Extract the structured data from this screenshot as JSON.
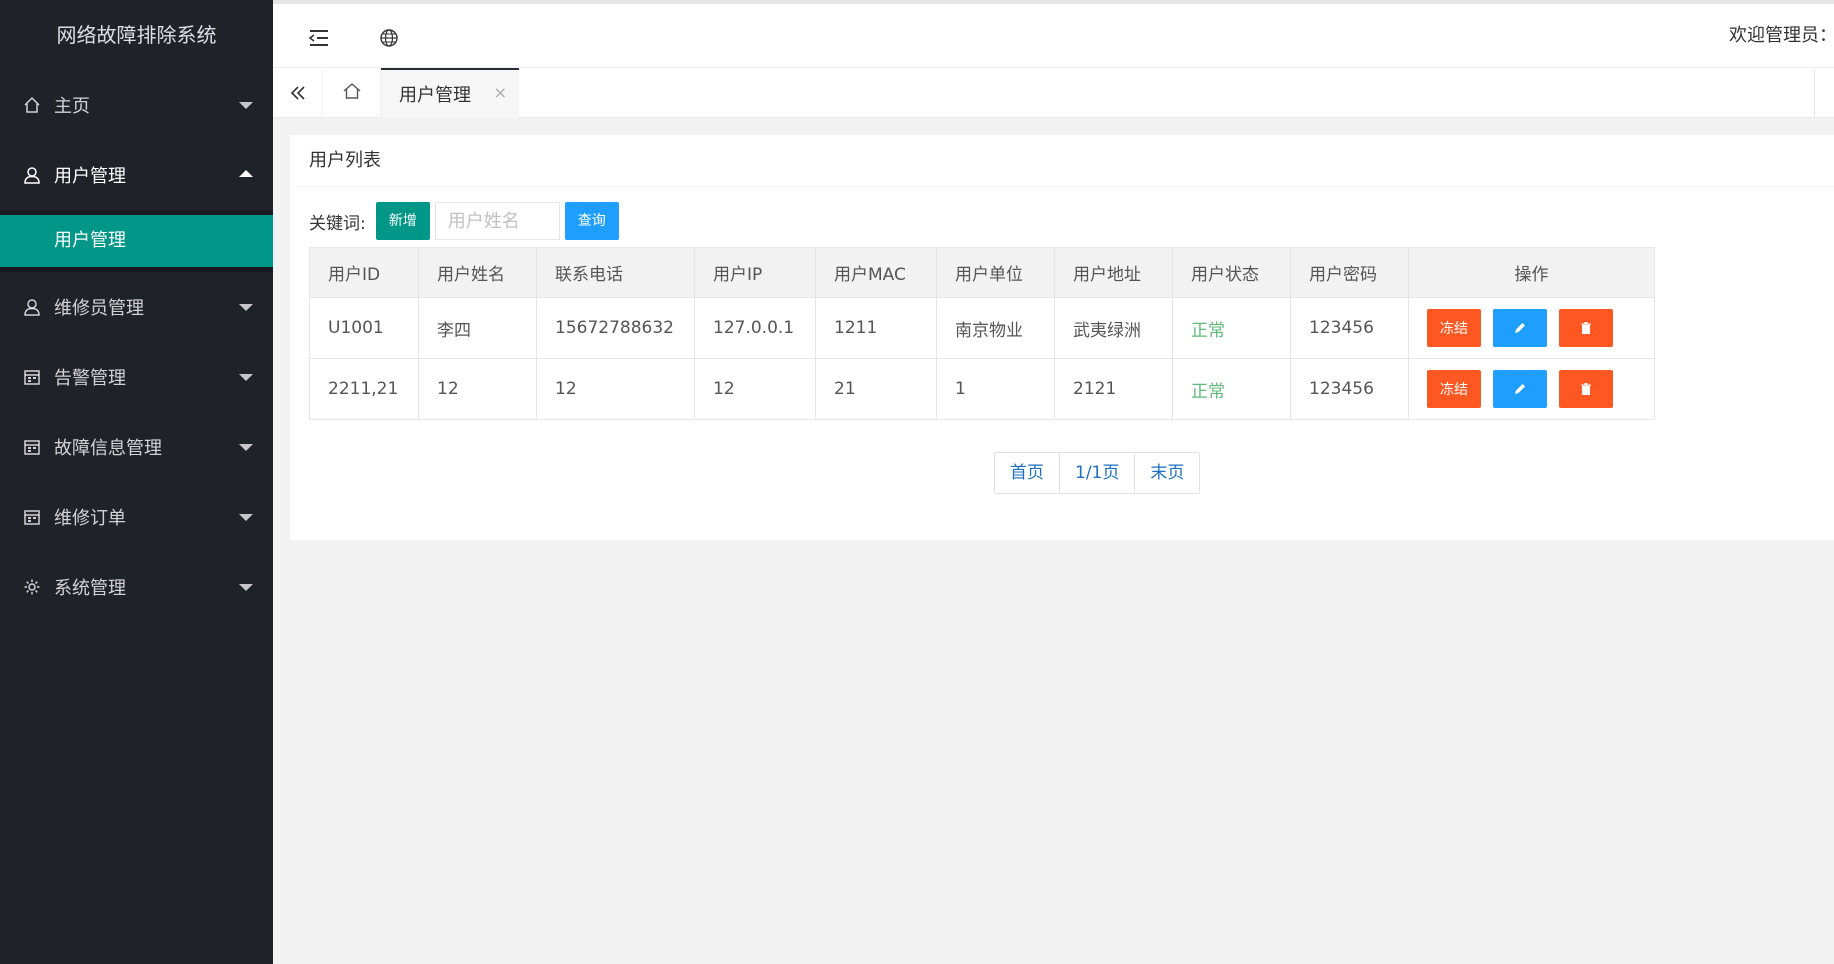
{
  "app": {
    "title": "网络故障排除系统"
  },
  "sidebar": {
    "items": [
      {
        "label": "主页",
        "icon": "home-icon"
      },
      {
        "label": "用户管理",
        "icon": "user-icon",
        "open": true,
        "children": [
          {
            "label": "用户管理"
          }
        ]
      },
      {
        "label": "维修员管理",
        "icon": "user-icon"
      },
      {
        "label": "告警管理",
        "icon": "calendar-icon"
      },
      {
        "label": "故障信息管理",
        "icon": "calendar-icon"
      },
      {
        "label": "维修订单",
        "icon": "calendar-icon"
      },
      {
        "label": "系统管理",
        "icon": "gear-icon"
      }
    ]
  },
  "header": {
    "welcome": "欢迎管理员：超"
  },
  "tabs": {
    "active": "用户管理",
    "close": "×"
  },
  "card": {
    "title": "用户列表",
    "keyword_label": "关键词:",
    "add_label": "新增",
    "search_placeholder": "用户姓名",
    "query_label": "查询"
  },
  "table": {
    "headers": [
      "用户ID",
      "用户姓名",
      "联系电话",
      "用户IP",
      "用户MAC",
      "用户单位",
      "用户地址",
      "用户状态",
      "用户密码",
      "操作"
    ],
    "rows": [
      [
        "U1001",
        "李四",
        "15672788632",
        "127.0.0.1",
        "1211",
        "南京物业",
        "武夷绿洲",
        "正常",
        "123456"
      ],
      [
        "2211,21",
        "12",
        "12",
        "12",
        "21",
        "1",
        "2121",
        "正常",
        "123456"
      ]
    ],
    "freeze_label": "冻结"
  },
  "pager": {
    "first": "首页",
    "current": "1/1页",
    "last": "末页"
  },
  "colors": {
    "sidebar_bg": "#20222a",
    "accent": "#009688",
    "blue": "#1e9fff",
    "orange": "#ff5722",
    "status_ok": "#5fb878"
  }
}
